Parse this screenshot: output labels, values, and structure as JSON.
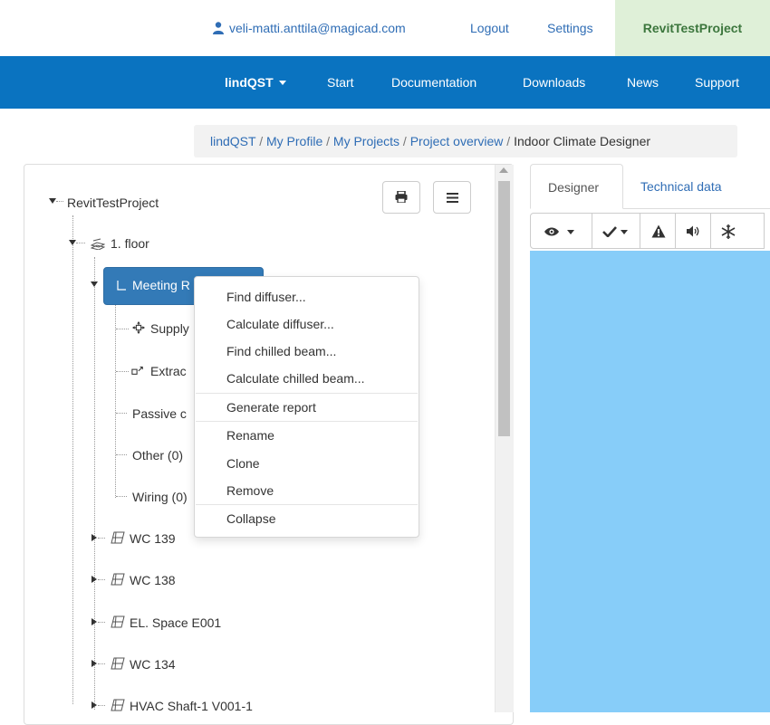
{
  "userbar": {
    "email": "veli-matti.anttila@magicad.com",
    "logout": "Logout",
    "settings": "Settings",
    "project": "RevitTestProject"
  },
  "navbar": {
    "brand": "lindQST",
    "items": [
      "Start",
      "Documentation",
      "Downloads",
      "News",
      "Support"
    ]
  },
  "breadcrumb": {
    "items": [
      "lindQST",
      "My Profile",
      "My Projects",
      "Project overview"
    ],
    "separator": "/",
    "active": "Indoor Climate Designer"
  },
  "tree": {
    "root": "RevitTestProject",
    "floor": "1. floor",
    "selected": "Meeting R",
    "children": [
      "Supply",
      "Extrac",
      "Passive c",
      "Other (0)",
      "Wiring (0)"
    ],
    "rooms": [
      "WC 139",
      "WC 138",
      "EL. Space E001",
      "WC 134",
      "HVAC Shaft-1 V001-1"
    ]
  },
  "context_menu": {
    "group1": [
      "Find diffuser...",
      "Calculate diffuser...",
      "Find chilled beam...",
      "Calculate chilled beam..."
    ],
    "group2": [
      "Generate report"
    ],
    "group3": [
      "Rename",
      "Clone",
      "Remove"
    ],
    "group4": [
      "Collapse"
    ]
  },
  "tabs": {
    "designer": "Designer",
    "technical": "Technical data"
  },
  "colors": {
    "navbar": "#0a73c0",
    "link": "#2f6db5",
    "selected": "#337ab7",
    "canvas": "#87cdf9",
    "project_tab": "#dff0d8"
  },
  "icons": [
    "user-icon",
    "print-icon",
    "hamburger-icon",
    "floor-icon",
    "room-icon",
    "supply-icon",
    "extract-icon",
    "eye-icon",
    "check-icon",
    "warning-icon",
    "sound-icon",
    "snowflake-icon"
  ]
}
